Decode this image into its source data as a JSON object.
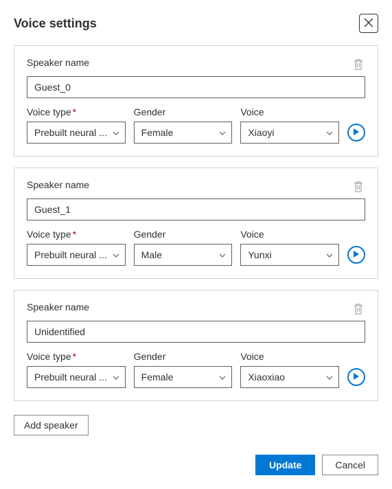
{
  "title": "Voice settings",
  "labels": {
    "speaker_name": "Speaker name",
    "voice_type": "Voice type",
    "gender": "Gender",
    "voice": "Voice"
  },
  "speakers": [
    {
      "name": "Guest_0",
      "voice_type": "Prebuilt neural ...",
      "gender": "Female",
      "voice": "Xiaoyi"
    },
    {
      "name": "Guest_1",
      "voice_type": "Prebuilt neural ...",
      "gender": "Male",
      "voice": "Yunxi"
    },
    {
      "name": "Unidentified",
      "voice_type": "Prebuilt neural ...",
      "gender": "Female",
      "voice": "Xiaoxiao"
    }
  ],
  "buttons": {
    "add_speaker": "Add speaker",
    "update": "Update",
    "cancel": "Cancel"
  }
}
